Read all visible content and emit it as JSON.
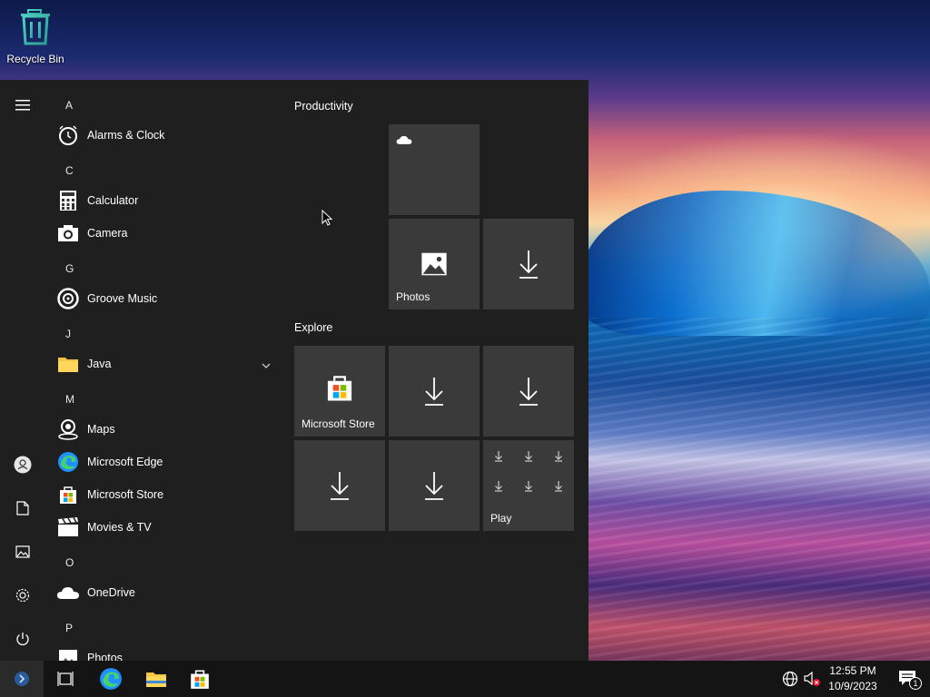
{
  "desktop": {
    "icons": [
      {
        "label": "Recycle Bin",
        "icon": "recycle-bin-icon"
      }
    ]
  },
  "start_menu": {
    "rail": [
      "hamburger-icon",
      "account-icon",
      "documents-icon",
      "pictures-icon",
      "settings-icon",
      "power-icon"
    ],
    "app_list": {
      "letters": [
        "A",
        "C",
        "G",
        "J",
        "M",
        "O",
        "P"
      ],
      "apps": [
        {
          "name": "Alarms & Clock",
          "icon": "alarm-clock-icon"
        },
        {
          "name": "Calculator",
          "icon": "calculator-icon"
        },
        {
          "name": "Camera",
          "icon": "camera-icon"
        },
        {
          "name": "Groove Music",
          "icon": "groove-music-icon"
        },
        {
          "name": "Java",
          "icon": "folder-icon"
        },
        {
          "name": "Maps",
          "icon": "maps-icon"
        },
        {
          "name": "Microsoft Edge",
          "icon": "edge-icon"
        },
        {
          "name": "Microsoft Store",
          "icon": "store-icon"
        },
        {
          "name": "Movies & TV",
          "icon": "movies-icon"
        },
        {
          "name": "OneDrive",
          "icon": "onedrive-icon"
        },
        {
          "name": "Photos",
          "icon": "photos-icon"
        }
      ]
    },
    "groups": {
      "productivity": "Productivity",
      "explore": "Explore"
    },
    "tiles": {
      "photos": "Photos",
      "store": "Microsoft Store",
      "play": "Play"
    }
  },
  "taskbar": {
    "time": "12:55 PM",
    "date": "10/9/2023",
    "notification_count": "1",
    "pinned": [
      "task-view-icon",
      "edge-icon",
      "file-explorer-icon",
      "store-icon"
    ],
    "tray": [
      "network-icon",
      "volume-muted-icon",
      "action-center-icon"
    ]
  },
  "colors": {
    "start_bg": "#1f1f1f",
    "tile_bg": "#3a3a3a",
    "taskbar_bg": "#141414",
    "accent": "#1e90ff"
  }
}
